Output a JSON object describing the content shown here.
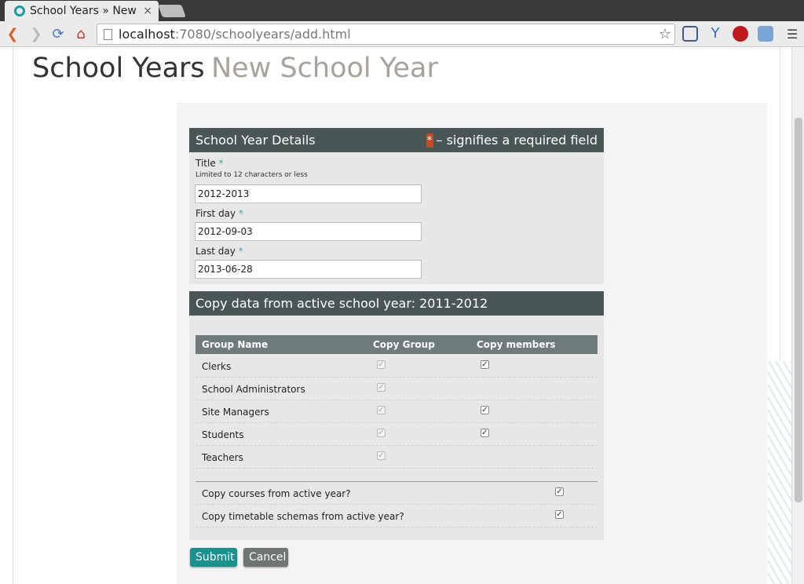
{
  "browser": {
    "tab_title": "School Years » New Sc",
    "tab_close": "×",
    "url_host": "localhost",
    "url_rest": ":7080/schoolyears/add.html"
  },
  "page": {
    "title": "School Years",
    "subtitle": "New School Year"
  },
  "details": {
    "legend": "School Year Details",
    "required_star": "*",
    "required_note": "– signifies a required field",
    "title_label": "Title",
    "title_help": "Limited to 12 characters or less",
    "title_value": "2012-2013",
    "first_day_label": "First day",
    "first_day_value": "2012-09-03",
    "last_day_label": "Last day",
    "last_day_value": "2013-06-28",
    "star": "*"
  },
  "copy": {
    "legend": "Copy data from active school year: 2011-2012",
    "headers": [
      "Group Name",
      "Copy Group",
      "Copy members"
    ],
    "groups": [
      {
        "name": "Clerks",
        "copy_group": true,
        "copy_members": true
      },
      {
        "name": "School Administrators",
        "copy_group": true,
        "copy_members": null
      },
      {
        "name": "Site Managers",
        "copy_group": true,
        "copy_members": true
      },
      {
        "name": "Students",
        "copy_group": true,
        "copy_members": true
      },
      {
        "name": "Teachers",
        "copy_group": true,
        "copy_members": null
      }
    ],
    "options": [
      {
        "label": "Copy courses from active year?",
        "checked": true
      },
      {
        "label": "Copy timetable schemas from active year?",
        "checked": true
      }
    ]
  },
  "buttons": {
    "submit": "Submit",
    "cancel": "Cancel"
  },
  "colors": {
    "accent": "#17928f",
    "legend_bg": "#4a5656",
    "required": "#c8491f"
  }
}
